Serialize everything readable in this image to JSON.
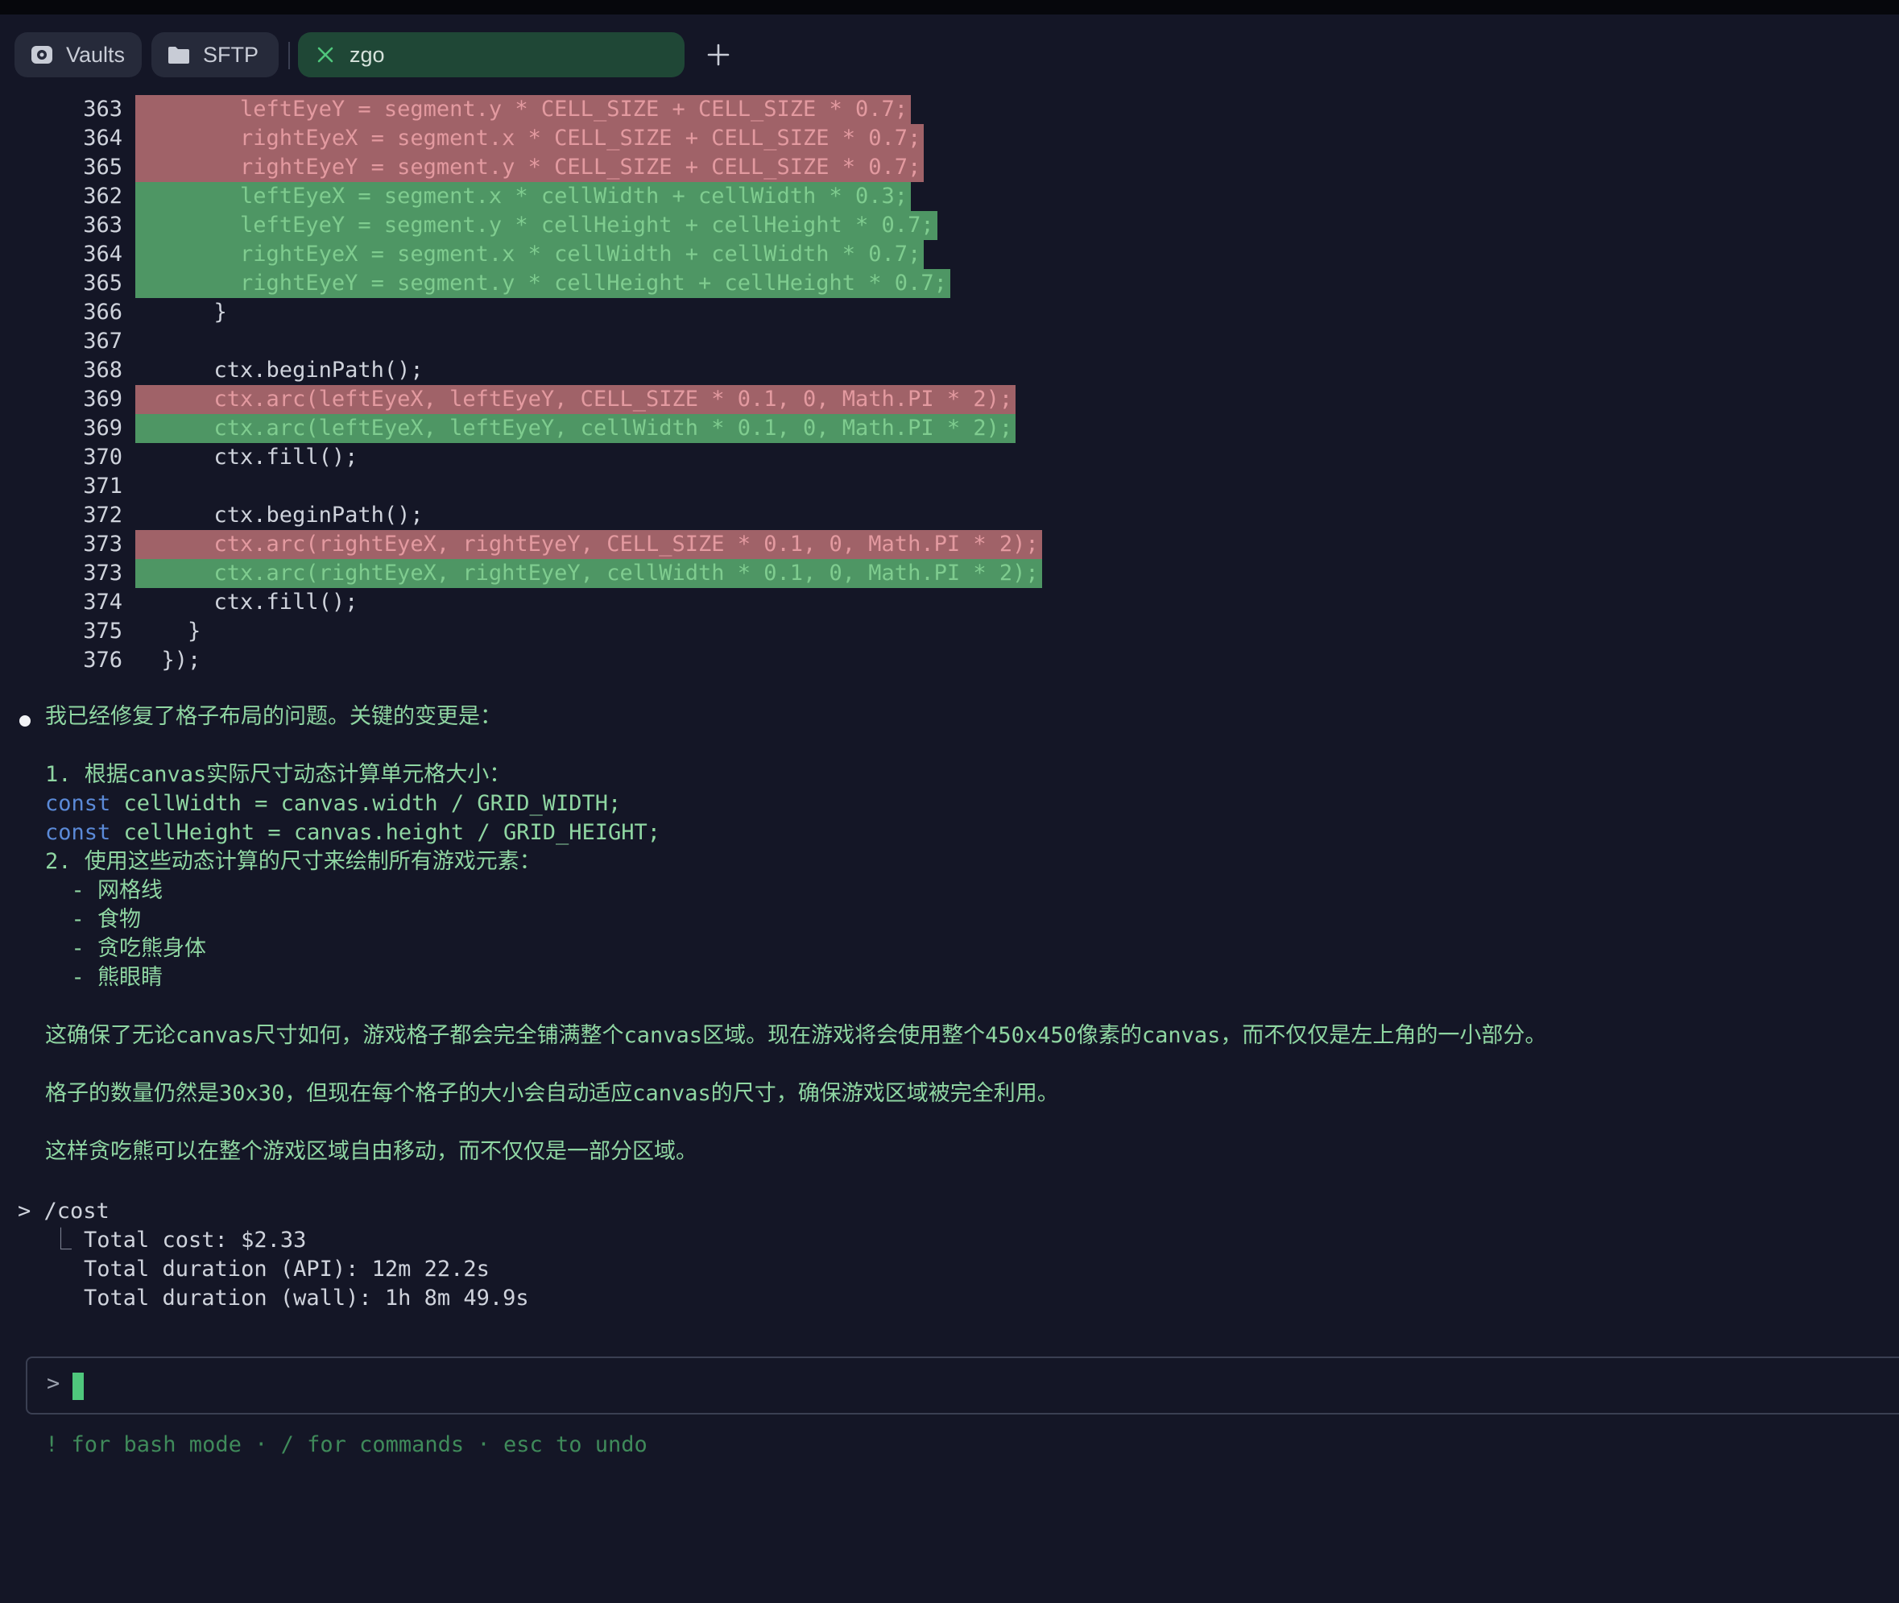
{
  "tabs": {
    "vaults": "Vaults",
    "sftp": "SFTP",
    "active": "zgo"
  },
  "code_lines": [
    {
      "num": "363",
      "text": "        leftEyeY = segment.y * CELL_SIZE + CELL_SIZE * 0.7;",
      "kind": "del"
    },
    {
      "num": "364",
      "text": "        rightEyeX = segment.x * CELL_SIZE + CELL_SIZE * 0.7;",
      "kind": "del"
    },
    {
      "num": "365",
      "text": "        rightEyeY = segment.y * CELL_SIZE + CELL_SIZE * 0.7;",
      "kind": "del"
    },
    {
      "num": "362",
      "text": "        leftEyeX = segment.x * cellWidth + cellWidth * 0.3;",
      "kind": "add"
    },
    {
      "num": "363",
      "text": "        leftEyeY = segment.y * cellHeight + cellHeight * 0.7;",
      "kind": "add"
    },
    {
      "num": "364",
      "text": "        rightEyeX = segment.x * cellWidth + cellWidth * 0.7;",
      "kind": "add"
    },
    {
      "num": "365",
      "text": "        rightEyeY = segment.y * cellHeight + cellHeight * 0.7;",
      "kind": "add"
    },
    {
      "num": "366",
      "text": "      }",
      "kind": "norm"
    },
    {
      "num": "367",
      "text": "",
      "kind": "norm"
    },
    {
      "num": "368",
      "text": "      ctx.beginPath();",
      "kind": "norm"
    },
    {
      "num": "369",
      "text": "      ctx.arc(leftEyeX, leftEyeY, CELL_SIZE * 0.1, 0, Math.PI * 2);",
      "kind": "del"
    },
    {
      "num": "369",
      "text": "      ctx.arc(leftEyeX, leftEyeY, cellWidth * 0.1, 0, Math.PI * 2);",
      "kind": "add"
    },
    {
      "num": "370",
      "text": "      ctx.fill();",
      "kind": "norm"
    },
    {
      "num": "371",
      "text": "",
      "kind": "norm"
    },
    {
      "num": "372",
      "text": "      ctx.beginPath();",
      "kind": "norm"
    },
    {
      "num": "373",
      "text": "      ctx.arc(rightEyeX, rightEyeY, CELL_SIZE * 0.1, 0, Math.PI * 2);",
      "kind": "del"
    },
    {
      "num": "373",
      "text": "      ctx.arc(rightEyeX, rightEyeY, cellWidth * 0.1, 0, Math.PI * 2);",
      "kind": "add"
    },
    {
      "num": "374",
      "text": "      ctx.fill();",
      "kind": "norm"
    },
    {
      "num": "375",
      "text": "    }",
      "kind": "norm"
    },
    {
      "num": "376",
      "text": "  });",
      "kind": "norm"
    }
  ],
  "message": {
    "intro": "我已经修复了格子布局的问题。关键的变更是：",
    "step1": "1. 根据canvas实际尺寸动态计算单元格大小：",
    "code1_kw": "const",
    "code1_rest": " cellWidth = canvas.width / GRID_WIDTH;",
    "code2_kw": "const",
    "code2_rest": " cellHeight = canvas.height / GRID_HEIGHT;",
    "step2": "2. 使用这些动态计算的尺寸来绘制所有游戏元素：",
    "items": [
      "  - 网格线",
      "  - 食物",
      "  - 贪吃熊身体",
      "  - 熊眼睛"
    ],
    "para1": "这确保了无论canvas尺寸如何，游戏格子都会完全铺满整个canvas区域。现在游戏将会使用整个450x450像素的canvas，而不仅仅是左上角的一小部分。",
    "para2": "格子的数量仍然是30x30，但现在每个格子的大小会自动适应canvas的尺寸，确保游戏区域被完全利用。",
    "para3": "这样贪吃熊可以在整个游戏区域自由移动，而不仅仅是一部分区域。"
  },
  "cost": {
    "command": "> /cost",
    "branch": "⎿",
    "total_cost": "Total cost: $2.33",
    "duration_api": "Total duration (API): 12m 22.2s",
    "duration_wall": "Total duration (wall): 1h 8m 49.9s"
  },
  "input": {
    "prompt": ">",
    "hint": "! for bash mode · / for commands · esc to undo"
  },
  "colors": {
    "background": "#141626",
    "deleted_line": "#a06268",
    "added_line": "#4e9664",
    "message_text": "#8fd6a2",
    "cursor": "#4fc77c"
  }
}
